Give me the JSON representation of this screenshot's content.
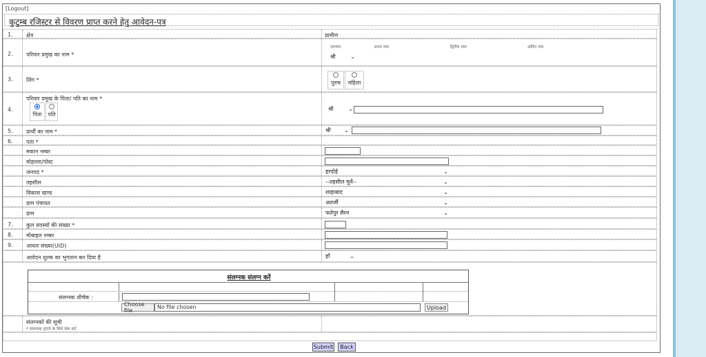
{
  "header": {
    "logout": "[Logout]",
    "title": "कुटुम्ब रजिस्टर से विवरण प्राप्त करने हेतु आवेदन-पत्र"
  },
  "rows": {
    "r1": {
      "num": "1.",
      "label": "क्षेत्र",
      "value": "ग्रामीण"
    },
    "r2": {
      "num": "2.",
      "label": "परिवार प्रमुख का नाम *",
      "sub": [
        "उपनाम",
        "प्रथम नाम",
        "द्वितीय नाम",
        "अंतिम नाम"
      ],
      "prefix": "श्री"
    },
    "r3": {
      "num": "3.",
      "label": "लिंग *",
      "opts": [
        "पुरुष",
        "महिला"
      ]
    },
    "r4": {
      "num": "4.",
      "label": "परिवार प्रमुख के पिता/ पति का नाम *",
      "opts": [
        "पिता",
        "पति"
      ],
      "prefix": "श्री"
    },
    "r5": {
      "num": "5.",
      "label": "प्रार्थी का नाम *",
      "prefix": "श्री"
    },
    "r6": {
      "num": "6.",
      "label": "पता *"
    },
    "house": {
      "label": "मकान नम्बर"
    },
    "mohalla": {
      "label": "मोहल्ला/पोस्ट"
    },
    "district": {
      "label": "जनपद *",
      "value": "हरदोई"
    },
    "tehsil": {
      "label": "तहसील",
      "value": "--तहसील चुनें--"
    },
    "block": {
      "label": "विकास खण्ड",
      "value": "शाहाबाद"
    },
    "panchayat": {
      "label": "ग्राम पंचायत",
      "value": "अतर्जी"
    },
    "village": {
      "label": "ग्राम",
      "value": "फतेपुर सैरन"
    },
    "r7": {
      "num": "7.",
      "label": "कुल सदस्यों की संख्या *"
    },
    "r8": {
      "num": "8.",
      "label": "मोबाइल नम्बर"
    },
    "r9": {
      "num": "9.",
      "label": "आधार संख्या(UID)"
    },
    "fee": {
      "label": "आवेदन शुल्क का भुगतान कर दिया है",
      "value": "हाँ"
    }
  },
  "attach": {
    "title": "संलग्नक संलग्न करें",
    "caption_label": "संलग्नक शीर्षक :",
    "choose": "Choose file",
    "nofile": "No file chosen",
    "upload": "Upload"
  },
  "list": {
    "title": "संलग्नकों की सूची",
    "note": "* संलग्नक हटाने के लिये चेक करें"
  },
  "buttons": {
    "submit": "Submit",
    "back": "Back"
  }
}
